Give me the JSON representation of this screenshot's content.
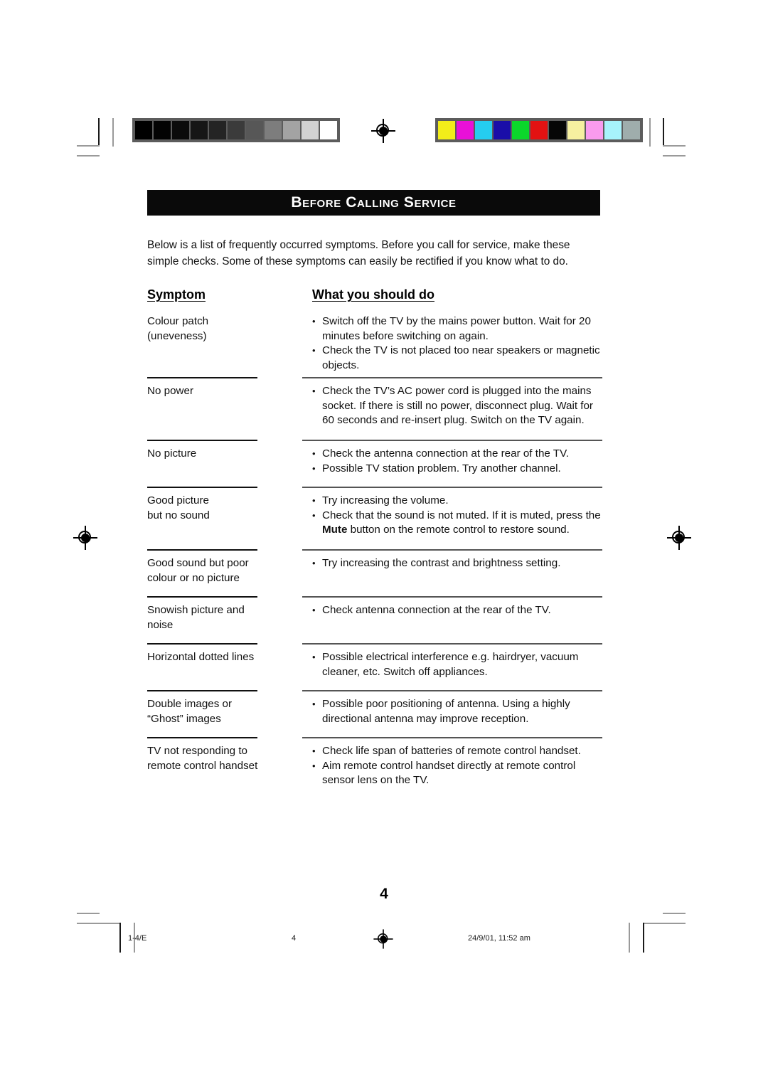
{
  "document": {
    "title": "Before Calling Service",
    "intro": "Below is a list of frequently occurred symptoms. Before you call for service, make these simple checks. Some of these symptoms can easily be rectified if you know what to do.",
    "page_number": "4"
  },
  "table": {
    "headers": {
      "symptom": "Symptom",
      "action": "What you should do"
    },
    "rows": [
      {
        "symptom": "Colour patch\n(uneveness)",
        "bullets": [
          "Switch off the TV by the mains power button. Wait for 20 minutes before switching on again.",
          "Check the TV is not placed too near speakers or magnetic objects."
        ]
      },
      {
        "symptom": "No power",
        "bullets": [
          "Check the TV’s AC power cord is plugged into the mains socket. If there is still no power, disconnect plug. Wait for 60 seconds and re-insert plug. Switch on the TV again."
        ]
      },
      {
        "symptom": "No picture",
        "bullets": [
          "Check the antenna connection at the rear of the TV.",
          "Possible TV station problem. Try another channel."
        ]
      },
      {
        "symptom": "Good picture\nbut no sound",
        "bullets": [
          "Try increasing the volume.",
          "Check that the sound is not muted. If it is muted, press the |Mute| button on the remote control to restore sound."
        ]
      },
      {
        "symptom": "Good sound but poor\ncolour or no picture",
        "bullets": [
          "Try increasing the contrast and brightness setting."
        ]
      },
      {
        "symptom": "Snowish picture and\nnoise",
        "bullets": [
          "Check antenna connection at the rear of the TV."
        ]
      },
      {
        "symptom": "Horizontal dotted lines",
        "bullets": [
          "Possible electrical interference e.g. hairdryer, vacuum cleaner, etc. Switch off appliances."
        ]
      },
      {
        "symptom": "Double images or\n “Ghost” images",
        "bullets": [
          "Possible poor positioning of antenna. Using a highly directional  antenna may improve reception."
        ]
      },
      {
        "symptom": "TV not responding to\nremote control handset",
        "bullets": [
          "Check life span of batteries of remote control handset.",
          "Aim remote control handset directly at remote control sensor lens on the TV."
        ]
      }
    ]
  },
  "footer": {
    "file_label": "1-4/E",
    "page_label": "4",
    "timestamp": "24/9/01, 11:52 am"
  },
  "calibration": {
    "grayscale": [
      "#000000",
      "#030303",
      "#0b0b0b",
      "#161616",
      "#242424",
      "#3b3b3b",
      "#575757",
      "#7d7d7d",
      "#a3a3a3",
      "#d2d2d2",
      "#ffffff"
    ],
    "colours": [
      "#f2ed1a",
      "#e910d8",
      "#25cdef",
      "#1a0ea8",
      "#0bd72b",
      "#e31212",
      "#060606",
      "#f6f0a0",
      "#fa9bee",
      "#a7f3fb",
      "#9fadac"
    ]
  }
}
